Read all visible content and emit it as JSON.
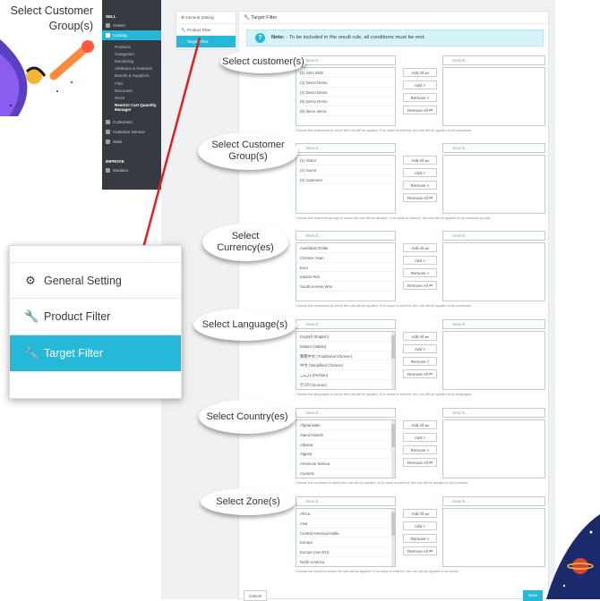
{
  "callout_title": "Select Customer Group(s)",
  "admin_sidebar": {
    "section_sell": "SELL",
    "orders": "Orders",
    "catalog": "Catalog",
    "catalog_sub": [
      "Products",
      "Categories",
      "Monitoring",
      "Attributes & Features",
      "Brands & Suppliers",
      "Files",
      "Discounts",
      "Stock",
      "Restrict Cart Quantity Manager"
    ],
    "customers": "Customers",
    "customer_service": "Customer Service",
    "stats": "Stats",
    "section_improve": "IMPROVE",
    "modules": "Modules"
  },
  "tabs": {
    "general": "General Setting",
    "product": "Product Filter",
    "target": "Target Filter"
  },
  "panel_title": "Target Filter",
  "note": {
    "label": "Note:",
    "text": " - To be included in the result rule, all conditions must be met."
  },
  "search_placeholder": "Search...",
  "buttons": {
    "add_all": "Add All ⏭",
    "add": "Add >",
    "remove": "Remove <",
    "remove_all": "Remove All ⏮"
  },
  "sections": [
    {
      "label": "Select customer(s)",
      "items": [
        "(1) John DOE",
        "(3) Demo Demo",
        "(4) Demo Demo",
        "(5) Demo Demo",
        "(6) demo demo"
      ],
      "help": "Choose the customers to which the rule will be applied. If no value is entered, the rule will be applied to all customers."
    },
    {
      "label": "Select Customer Group(s)",
      "items": [
        "(1) Visitor",
        "(2) Guest",
        "(3) Customer"
      ],
      "help": "Choose the customer groups to which the rule will be applied. If no value is entered, the rule will be applied to all customer groups."
    },
    {
      "label": "Select Currency(es)",
      "items": [
        "Australian Dollar",
        "Chinese Yuan",
        "Euro",
        "Iranian Rial",
        "South Korean Won"
      ],
      "help": "Choose the currencies to which the rule will be applied. If no value is entered, the rule will be applied to all currencies."
    },
    {
      "label": "Select Language(s)",
      "items": [
        "English (English)",
        "Italiano (Italian)",
        "繁體中文 (Traditional Chinese)",
        "中文 (Simplified Chinese)",
        "فارسی (Persian)",
        "한국어 (Korean)"
      ],
      "help": "Choose the languages to which the rule will be applied. If no value is entered, the rule will be applied to all languages."
    },
    {
      "label": "Select Country(es)",
      "items": [
        "Afghanistan",
        "Aland Islands",
        "Albania",
        "Algeria",
        "American Samoa",
        "Andorra"
      ],
      "help": "Choose the countries to which the rule will be applied. If no value is entered, the rule will be applied to all countries."
    },
    {
      "label": "Select Zone(s)",
      "items": [
        "Africa",
        "Asia",
        "Central America/Antilla",
        "Europe",
        "Europe (non-EU)",
        "North America"
      ],
      "help": "Choose the zones to which the rule will be applied. If no value is entered, the rule will be applied to all zones."
    }
  ],
  "footer": {
    "cancel": "Cancel",
    "save": "Save"
  },
  "colors": {
    "accent": "#25b9d7",
    "sidebar": "#363a41",
    "connector": "#e02020"
  }
}
